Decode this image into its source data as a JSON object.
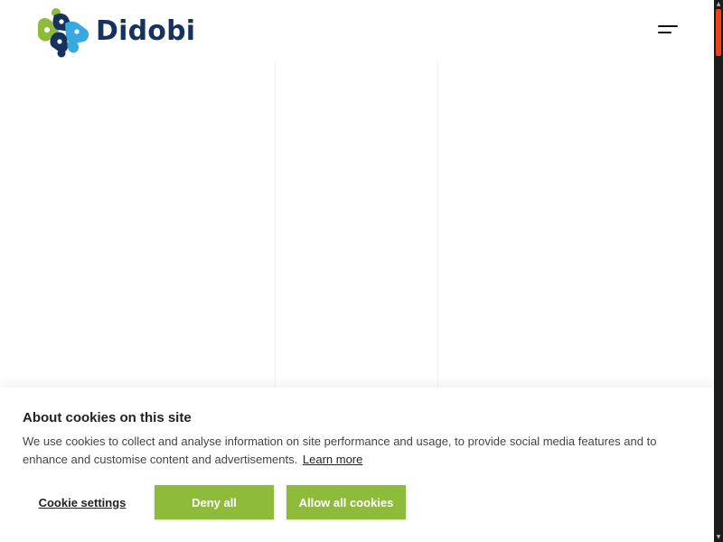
{
  "header": {
    "brand_name": "Didobi",
    "logo_icon": "didobi-molecule-logo-icon",
    "menu_icon": "hamburger-menu-icon"
  },
  "cookie_banner": {
    "title": "About cookies on this site",
    "body": "We use cookies to collect and analyse information on site performance and usage, to provide social media features and to enhance and customise content and advertisements.",
    "learn_more": "Learn more",
    "buttons": {
      "settings": "Cookie settings",
      "deny": "Deny all",
      "allow": "Allow all cookies"
    }
  },
  "colors": {
    "brand_green": "#8fbb3a",
    "brand_navy": "#16335f",
    "brand_blue": "#36a9e1",
    "scroll_accent": "#e8431c"
  },
  "scrollbar": {
    "up_icon": "scroll-up-arrow-icon",
    "down_icon": "scroll-down-arrow-icon"
  }
}
